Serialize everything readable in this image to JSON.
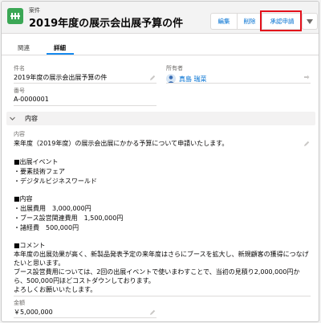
{
  "header": {
    "object_type": "案件",
    "record_title": "2019年度の展示会出展予算の件",
    "buttons": {
      "edit": "編集",
      "delete": "削除",
      "approval_request": "承認申請"
    }
  },
  "tabs": {
    "related": "関連",
    "detail": "詳細"
  },
  "fields": {
    "name_label": "件名",
    "name_value": "2019年度の展示会出展予算の件",
    "owner_label": "所有者",
    "owner_value": "真島 瑞菜",
    "number_label": "番号",
    "number_value": "A-0000001"
  },
  "section": {
    "title": "内容"
  },
  "content": {
    "label": "内容",
    "lines": [
      "来年度（2019年度）の展示会出展にかかる予算について申請いたします。",
      "■出展イベント",
      "・要素技術フェア",
      "・デジタルビジネスワールド",
      "■内容",
      "・出展費用　3,000,000円",
      "・ブース設営関連費用　1,500,000円",
      "・諸経費　500,000円",
      "■コメント",
      "本年度の出展効果が高く、新製品発表予定の来年度はさらにブースを拡大し、新規顧客の獲得につなげ",
      "たいと思います。",
      "ブース設営費用については、2回の出展イベントで使いまわすことで、当初の見積り2,000,000円か",
      "ら、500,000円ほどコストダウンしております。",
      "よろしくお願いいたします。"
    ]
  },
  "amount": {
    "label": "金額",
    "value": "￥5,000,000"
  },
  "colors": {
    "accent": "#0070d2",
    "app_icon": "#3ba755",
    "highlight": "#e3101b",
    "tab_active": "#1589ee"
  },
  "icons": {
    "app": "approval-icon",
    "more": "chevron-down-icon",
    "edit": "pencil-icon",
    "owner": "user-avatar-icon",
    "owner_change": "change-owner-icon",
    "section": "chevron-down-icon"
  }
}
